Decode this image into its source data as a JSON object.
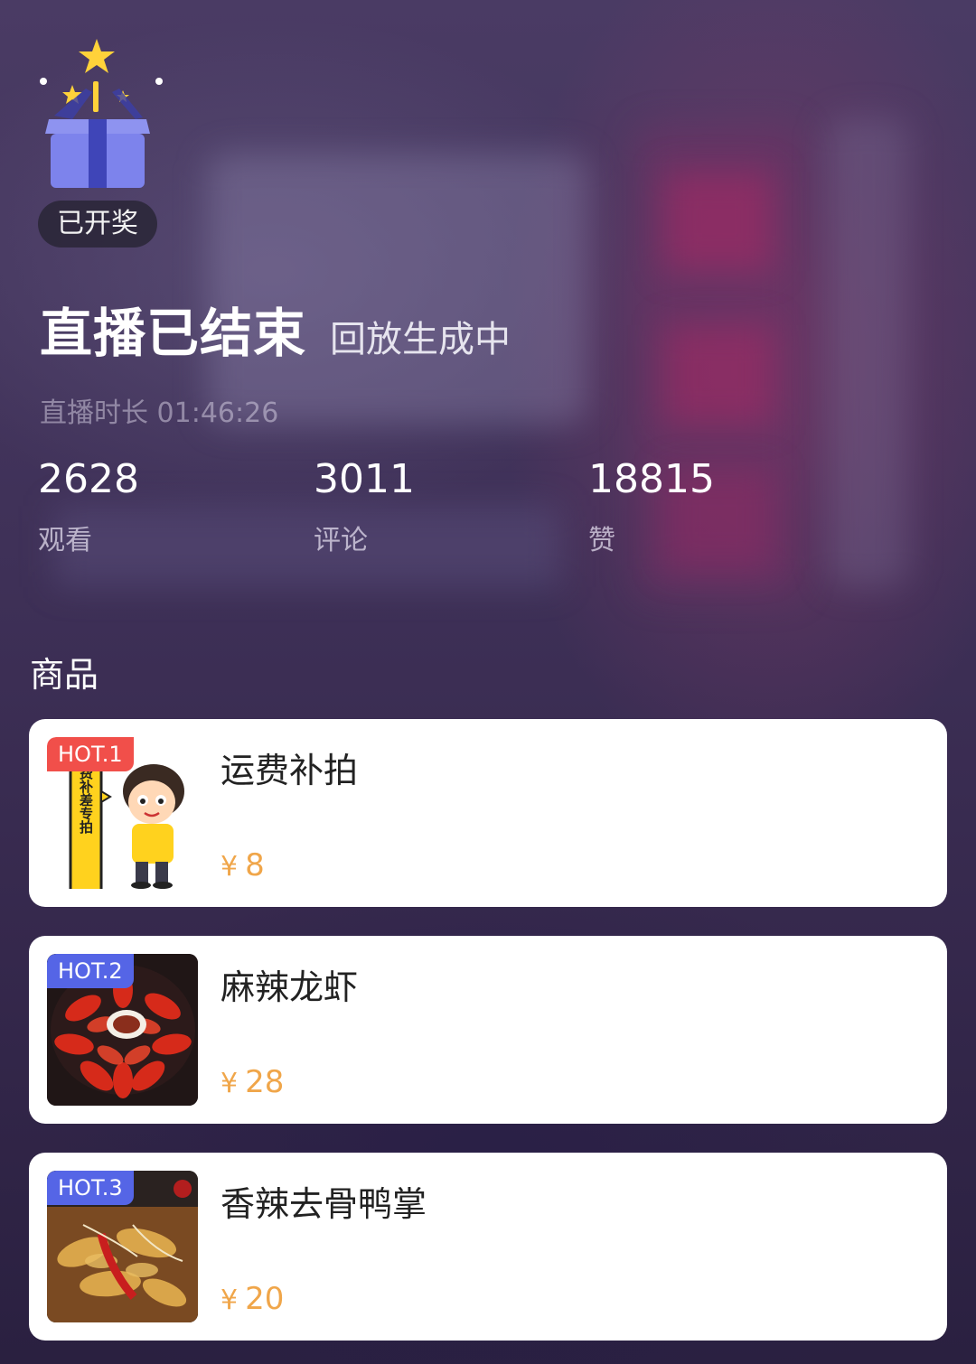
{
  "status": {
    "lottery_badge": "已开奖",
    "title": "直播已结束",
    "subtitle": "回放生成中",
    "duration_label": "直播时长",
    "duration_value": "01:46:26"
  },
  "stats": [
    {
      "value": "2628",
      "label": "观看"
    },
    {
      "value": "3011",
      "label": "评论"
    },
    {
      "value": "18815",
      "label": "赞"
    }
  ],
  "products_section": {
    "title": "商品",
    "currency": "¥",
    "items": [
      {
        "tag": "HOT.1",
        "tag_color": "#f14f4a",
        "name": "运费补拍",
        "price": "8",
        "thumb_text": "邮费补差专拍",
        "thumb_icon": "cartoon-boy-icon"
      },
      {
        "tag": "HOT.2",
        "tag_color": "#5565e6",
        "name": "麻辣龙虾",
        "price": "28",
        "thumb_icon": "crayfish-plate-image"
      },
      {
        "tag": "HOT.3",
        "tag_color": "#5565e6",
        "name": "香辣去骨鸭掌",
        "price": "20",
        "thumb_icon": "duck-feet-dish-image"
      }
    ]
  },
  "colors": {
    "price": "#f0a64a",
    "hot_red": "#f14f4a",
    "hot_blue": "#5565e6"
  }
}
